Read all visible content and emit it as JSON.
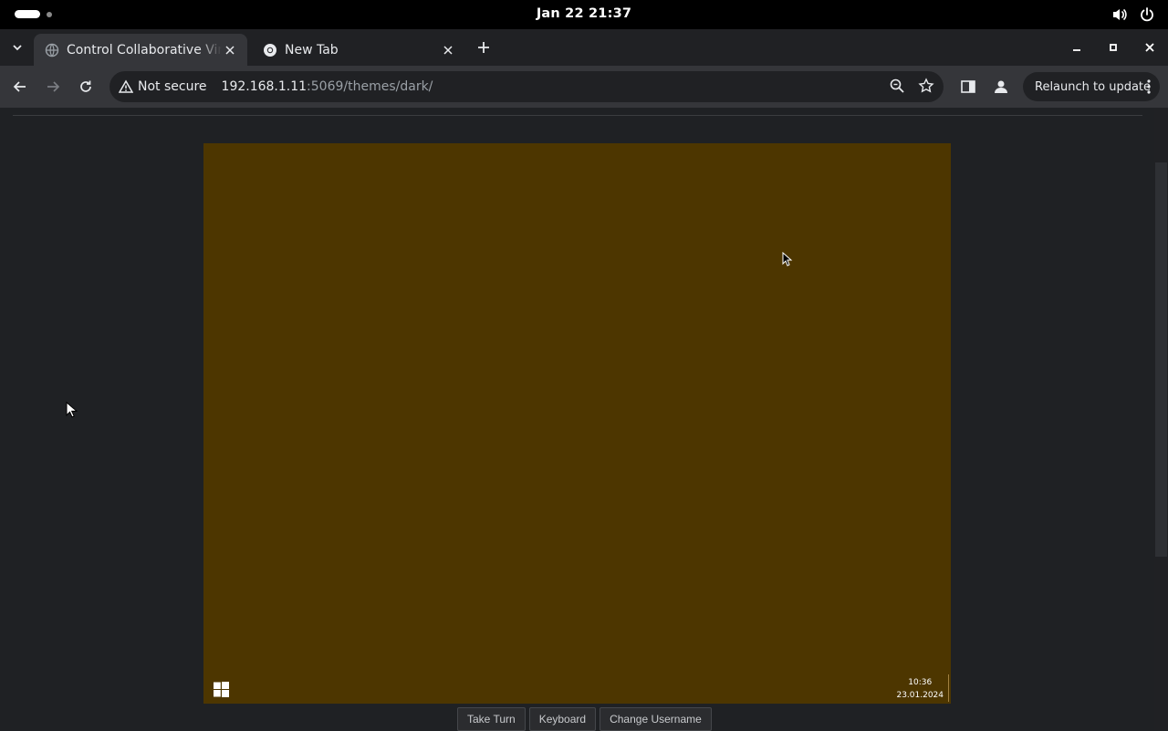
{
  "system": {
    "clock": "Jan 22  21:37",
    "tray_icons": [
      "volume-icon",
      "power-icon"
    ]
  },
  "browser": {
    "tabs": [
      {
        "title": "Control Collaborative Virtual",
        "active": true,
        "favicon": "globe-icon"
      },
      {
        "title": "New Tab",
        "active": false,
        "favicon": "chrome-icon"
      }
    ],
    "security_label": "Not secure",
    "url_host": "192.168.1.11",
    "url_rest": ":5069/themes/dark/",
    "relaunch_label": "Relaunch to update"
  },
  "vm": {
    "desktop_color": "#4d3600",
    "taskbar_time": "10:36",
    "taskbar_date": "23.01.2024"
  },
  "controls": {
    "take_turn": "Take Turn",
    "keyboard": "Keyboard",
    "change_username": "Change Username"
  }
}
